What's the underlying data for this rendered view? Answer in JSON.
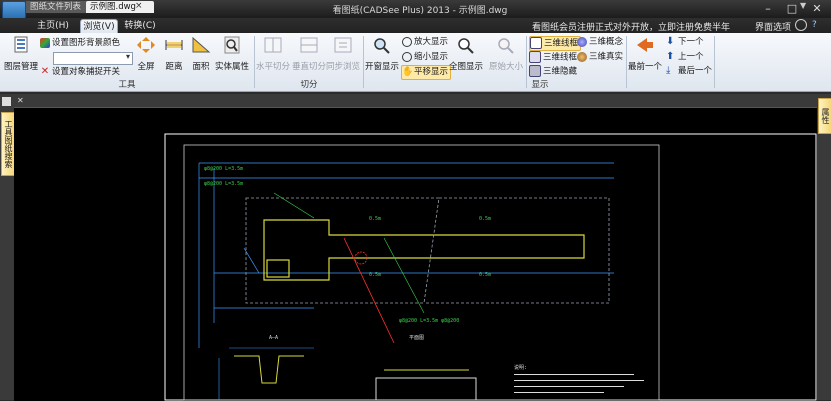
{
  "titlebar": {
    "title": "看图纸(CADSee Plus) 2013 - 示例图.dwg",
    "quick_access": [
      "folder-open-icon",
      "save-icon",
      "print-icon",
      "undo-icon",
      "dropdown-arrow-icon"
    ],
    "controls": {
      "minimize": "–",
      "maximize": "□",
      "close": "✕"
    }
  },
  "menu": {
    "tabs": [
      {
        "label": "主页(H)",
        "active": false
      },
      {
        "label": "浏览(V)",
        "active": true
      },
      {
        "label": "转换(C)",
        "active": false
      }
    ],
    "notice": "看图纸会员注册正式对外开放，立即注册免费半年",
    "ui_options": "界面选项",
    "help": "?"
  },
  "ribbon": {
    "tools_group": {
      "label": "工具",
      "layer_manager": "图层管理",
      "set_background": "设置图形背景颜色",
      "set_snap": "设置对象捕捉开关",
      "fullscreen": "全屏",
      "distance": "距离",
      "area": "面积",
      "entity_props": "实体属性"
    },
    "split_group": {
      "label": "切分",
      "horizontal": "水平切分",
      "vertical": "垂直切分",
      "sync": "同步浏览"
    },
    "display_group": {
      "label": "显示",
      "window_display": "开窗显示",
      "zoom_in": "放大显示",
      "zoom_out": "缩小显示",
      "pan": "平移显示",
      "full_display": "全图显示",
      "original_size": "原始大小",
      "wire_3d": "三维线框",
      "concept_3d": "三维概念",
      "wire_3d2": "三维线框",
      "real_3d": "三维真实",
      "hidden_3d": "三维隐藏",
      "latest": "最前一个",
      "next": "下一个",
      "prev": "上一个",
      "last": "最后一个"
    }
  },
  "side": {
    "left_tab": "工具图纸搜索",
    "right_tab": "属性"
  },
  "doctabs": {
    "list": "图纸文件列表",
    "active": "示例图.dwg",
    "close": "×",
    "arrow": "▼"
  },
  "drawing": {
    "dims": {
      "d1": "φ8@200 L=3.5m",
      "d2": "φ8@200 L=3.5m",
      "w1": "0.5m",
      "w2": "0.5m",
      "w3": "0.5m",
      "w4": "0.5m",
      "bottom": "φ8@200 L=3.5m  φ8@200",
      "sectionA": "A—A",
      "note_title": "说明:",
      "plan": "平面图"
    }
  }
}
